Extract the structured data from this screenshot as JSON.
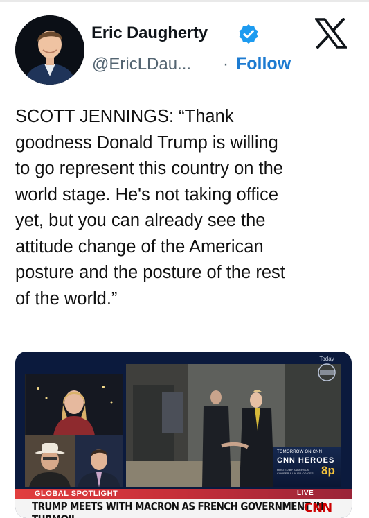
{
  "author": {
    "name": "Eric Daugherty",
    "handle": "@EricLDau...",
    "separator": "·",
    "follow_label": "Follow",
    "verified_icon": "verified-badge-icon",
    "verified_color": "#1d9bf0"
  },
  "platform": {
    "logo_icon": "x-logo-icon"
  },
  "tweet": {
    "text": "SCOTT JENNINGS: “Thank\ngoodness Donald Trump is willing\nto go represent this country on the\nworld stage. He's not taking office\nyet, but you can already see the\nattitude change of the American\nposture and the posture of the rest\nof the world.”"
  },
  "media": {
    "spotlight": "GLOBAL SPOTLIGHT",
    "live": "LIVE",
    "headline": "TRUMP MEETS WITH MACRON AS FRENCH GOVERNMENT IN TURMOIL",
    "network_logo": "CNN",
    "promo": {
      "line1": "TOMORROW ON CNN",
      "line2": "CNN HEROES",
      "line3": "HOSTED BY ANDERSON COOPER & LAURA COATES",
      "time": "8p"
    },
    "badge": "Today"
  },
  "colors": {
    "follow": "#1d7bd1",
    "spotlight_red": "#e13e3e",
    "cnn_red": "#cc0000"
  }
}
